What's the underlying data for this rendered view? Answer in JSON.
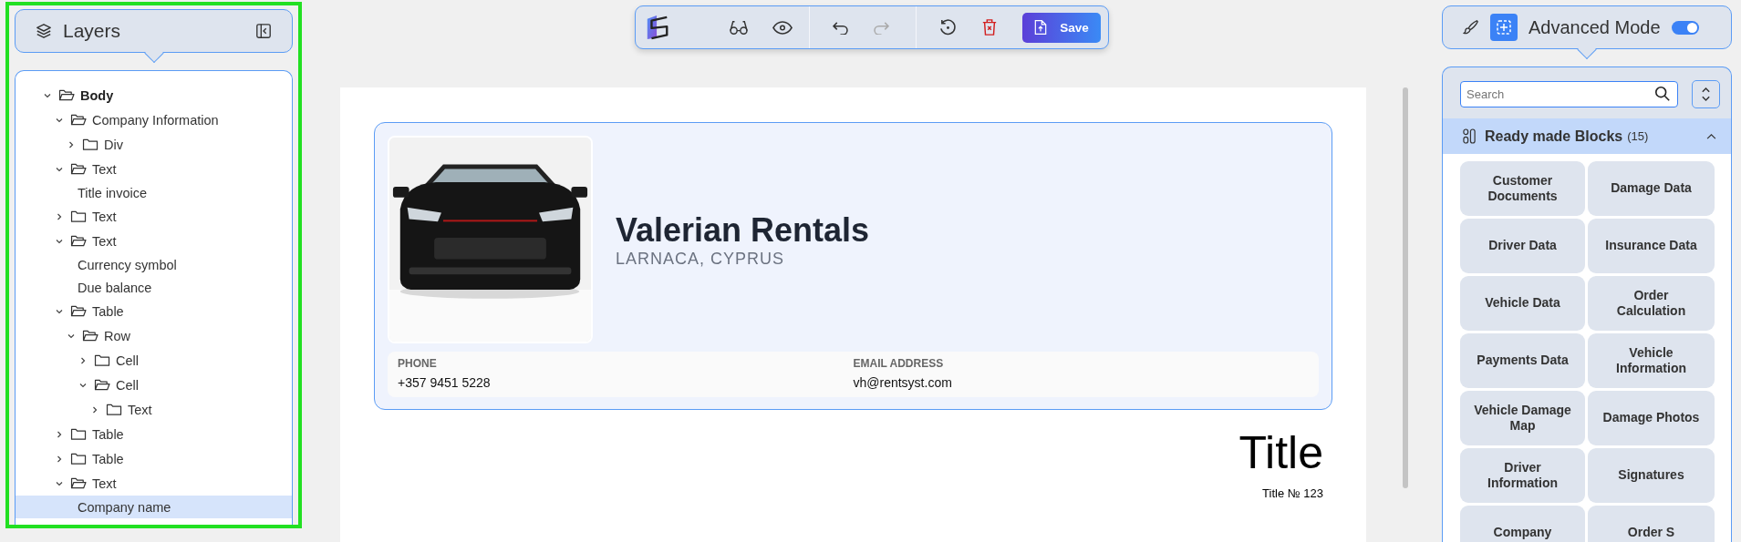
{
  "layers_panel": {
    "title": "Layers",
    "tree": [
      {
        "kind": "folder",
        "label": "Body",
        "expanded": true,
        "selected": false,
        "children": [
          {
            "kind": "folder",
            "label": "Company Information",
            "expanded": true,
            "selected": false,
            "children": [
              {
                "kind": "folder",
                "label": "Div",
                "expanded": false,
                "selected": false
              }
            ]
          },
          {
            "kind": "folder",
            "label": "Text",
            "expanded": true,
            "selected": false,
            "children": [
              {
                "kind": "leaf",
                "label": "Title invoice",
                "selected": false
              }
            ]
          },
          {
            "kind": "folder",
            "label": "Text",
            "expanded": false,
            "selected": false
          },
          {
            "kind": "folder",
            "label": "Text",
            "expanded": true,
            "selected": false,
            "children": [
              {
                "kind": "leaf",
                "label": "Currency symbol",
                "selected": false
              },
              {
                "kind": "leaf",
                "label": "Due balance",
                "selected": false
              }
            ]
          },
          {
            "kind": "folder",
            "label": "Table",
            "expanded": true,
            "selected": false,
            "children": [
              {
                "kind": "folder",
                "label": "Row",
                "expanded": true,
                "selected": false,
                "children": [
                  {
                    "kind": "folder",
                    "label": "Cell",
                    "expanded": false,
                    "selected": false
                  },
                  {
                    "kind": "folder",
                    "label": "Cell",
                    "expanded": true,
                    "selected": false,
                    "children": [
                      {
                        "kind": "folder",
                        "label": "Text",
                        "expanded": false,
                        "selected": false
                      }
                    ]
                  }
                ]
              }
            ]
          },
          {
            "kind": "folder",
            "label": "Table",
            "expanded": false,
            "selected": false
          },
          {
            "kind": "folder",
            "label": "Table",
            "expanded": false,
            "selected": false
          },
          {
            "kind": "folder",
            "label": "Text",
            "expanded": true,
            "selected": false,
            "children": [
              {
                "kind": "leaf",
                "label": "Company name",
                "selected": true
              }
            ]
          }
        ]
      }
    ]
  },
  "toolbar": {
    "redo": {
      "disabled": true
    },
    "save": "Save"
  },
  "document": {
    "company_name": "Valerian Rentals",
    "location": "LARNACA, CYPRUS",
    "contacts": [
      {
        "label": "PHONE",
        "value": "+357 9451 5228"
      },
      {
        "label": "EMAIL ADDRESS",
        "value": "vh@rentsyst.com"
      }
    ],
    "title": "Title",
    "subtitle": "Title № 123"
  },
  "blocks_panel": {
    "mode_label": "Advanced Mode",
    "mode_on": true,
    "search": {
      "placeholder": "Search"
    },
    "section": {
      "title": "Ready made Blocks",
      "count": "(15)",
      "expanded": true
    },
    "blocks": [
      "Customer Documents",
      "Damage Data",
      "Driver Data",
      "Insurance Data",
      "Vehicle Data",
      "Order Calculation",
      "Payments Data",
      "Vehicle Information",
      "Vehicle Damage Map",
      "Damage Photos",
      "Driver Information",
      "Signatures",
      "Company",
      "Order S"
    ]
  }
}
